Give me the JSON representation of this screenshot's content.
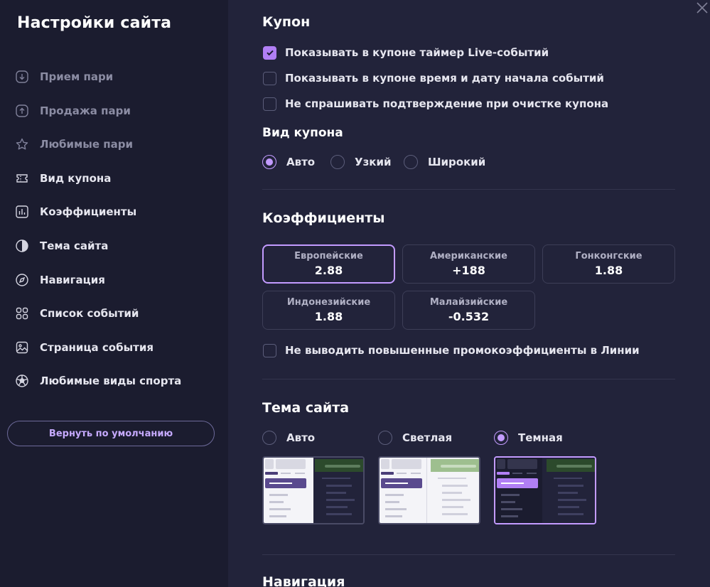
{
  "sidebar": {
    "title": "Настройки сайта",
    "items": [
      {
        "label": "Прием пари",
        "icon": "arrow-down-circle-icon",
        "dim": true
      },
      {
        "label": "Продажа пари",
        "icon": "arrow-up-circle-icon",
        "dim": true
      },
      {
        "label": "Любимые пари",
        "icon": "star-icon",
        "dim": true
      },
      {
        "label": "Вид купона",
        "icon": "ticket-icon",
        "dim": false
      },
      {
        "label": "Коэффициенты",
        "icon": "bar-chart-icon",
        "dim": false
      },
      {
        "label": "Тема сайта",
        "icon": "half-circle-icon",
        "dim": false
      },
      {
        "label": "Навигация",
        "icon": "compass-icon",
        "dim": false
      },
      {
        "label": "Список событий",
        "icon": "grid-icon",
        "dim": false
      },
      {
        "label": "Страница события",
        "icon": "image-icon",
        "dim": false
      },
      {
        "label": "Любимые виды спорта",
        "icon": "soccer-ball-icon",
        "dim": false
      }
    ],
    "reset_label": "Вернуть по умолчанию"
  },
  "coupon": {
    "title": "Купон",
    "options": [
      {
        "label": "Показывать в купоне таймер Live-событий",
        "checked": true
      },
      {
        "label": "Показывать в купоне время и дату начала событий",
        "checked": false
      },
      {
        "label": "Не спрашивать подтверждение при очистке купона",
        "checked": false
      }
    ],
    "view_title": "Вид купона",
    "views": [
      {
        "label": "Авто",
        "selected": true
      },
      {
        "label": "Узкий",
        "selected": false
      },
      {
        "label": "Широкий",
        "selected": false
      }
    ]
  },
  "odds": {
    "title": "Коэффициенты",
    "formats": [
      {
        "name": "Европейские",
        "value": "2.88",
        "selected": true
      },
      {
        "name": "Американские",
        "value": "+188",
        "selected": false
      },
      {
        "name": "Гонконгские",
        "value": "1.88",
        "selected": false
      },
      {
        "name": "Индонезийские",
        "value": "1.88",
        "selected": false
      },
      {
        "name": "Малайзийские",
        "value": "-0.532",
        "selected": false
      }
    ],
    "promo_label": "Не выводить повышенные промокоэффициенты в Линии",
    "promo_checked": false
  },
  "theme": {
    "title": "Тема сайта",
    "options": [
      {
        "label": "Авто",
        "selected": false
      },
      {
        "label": "Светлая",
        "selected": false
      },
      {
        "label": "Темная",
        "selected": true
      }
    ]
  },
  "navigation": {
    "title": "Навигация"
  },
  "colors": {
    "accent": "#c39bff",
    "background": "#22233a",
    "sidebar": "#1b1c2f"
  }
}
